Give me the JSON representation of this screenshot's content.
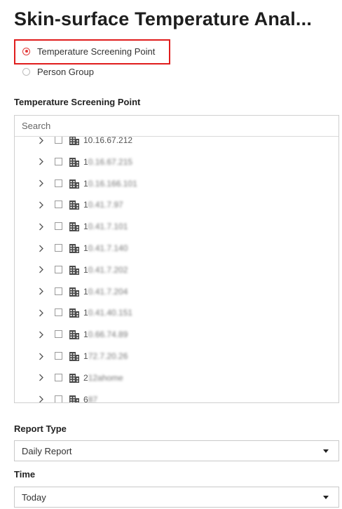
{
  "page": {
    "title": "Skin-surface Temperature Anal..."
  },
  "source_options": [
    {
      "label": "Temperature Screening Point",
      "checked": true
    },
    {
      "label": "Person Group",
      "checked": false
    }
  ],
  "tree_section": {
    "label": "Temperature Screening Point",
    "search_placeholder": "Search",
    "items": [
      {
        "label_visible": "10.16.67.212",
        "masked": false
      },
      {
        "label_visible": "1",
        "label_masked": "0.16.67.215",
        "masked": true
      },
      {
        "label_visible": "1",
        "label_masked": "0.16.166.101",
        "masked": true
      },
      {
        "label_visible": "1",
        "label_masked": "0.41.7.97",
        "masked": true
      },
      {
        "label_visible": "1",
        "label_masked": "0.41.7.101",
        "masked": true
      },
      {
        "label_visible": "1",
        "label_masked": "0.41.7.140",
        "masked": true
      },
      {
        "label_visible": "1",
        "label_masked": "0.41.7.202",
        "masked": true
      },
      {
        "label_visible": "1",
        "label_masked": "0.41.7.204",
        "masked": true
      },
      {
        "label_visible": "1",
        "label_masked": "0.41.40.151",
        "masked": true
      },
      {
        "label_visible": "1",
        "label_masked": "0.66.74.89",
        "masked": true
      },
      {
        "label_visible": "1",
        "label_masked": "72.7.20.26",
        "masked": true
      },
      {
        "label_visible": "2",
        "label_masked": "12ahome",
        "masked": true
      },
      {
        "label_visible": "6",
        "label_masked": "87",
        "masked": true
      }
    ]
  },
  "report_type": {
    "label": "Report Type",
    "selected": "Daily Report"
  },
  "time": {
    "label": "Time",
    "selected": "Today"
  },
  "colors": {
    "highlight_border": "#e01d1d",
    "radio_accent": "#e23b3b",
    "building_icon": "#4a4a4a"
  }
}
